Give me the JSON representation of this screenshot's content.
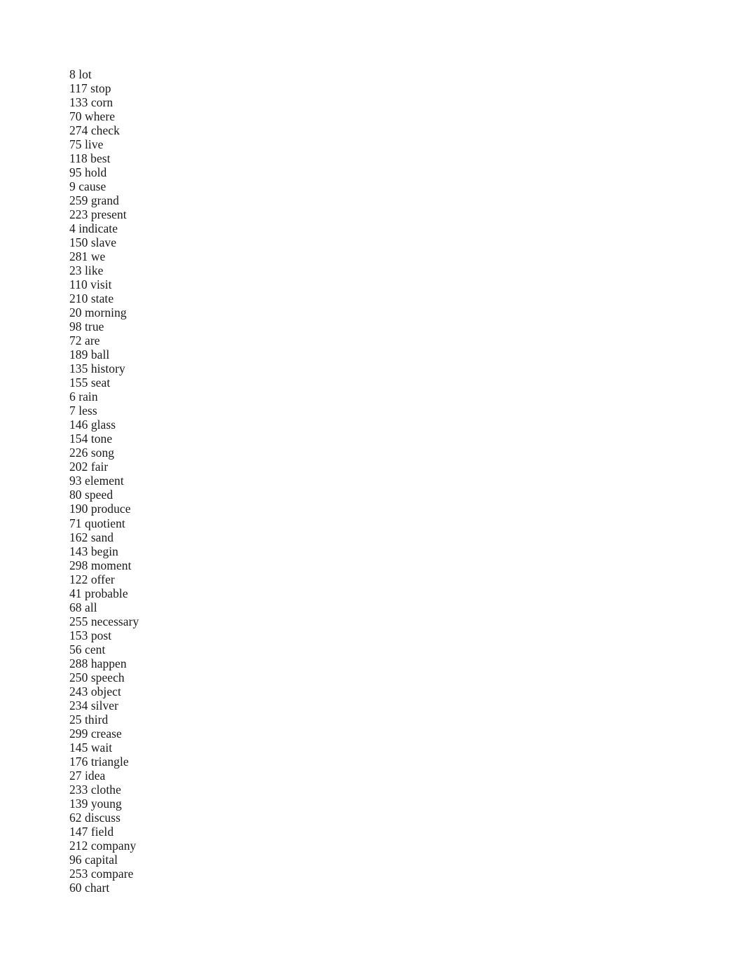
{
  "document": {
    "page_background": "#ffffff",
    "text_color": "#1a1a1a",
    "lines": [
      "8 lot",
      "117 stop",
      "133 corn",
      "70 where",
      "274 check",
      "75 live",
      "118 best",
      "95 hold",
      "9 cause",
      "259 grand",
      "223 present",
      "4 indicate",
      "150 slave",
      "281 we",
      "23 like",
      "110 visit",
      "210 state",
      "20 morning",
      "98 true",
      "72 are",
      "189 ball",
      "135 history",
      "155 seat",
      "6 rain",
      "7 less",
      "146 glass",
      "154 tone",
      "226 song",
      "202 fair",
      "93 element",
      "80 speed",
      "190 produce",
      "71 quotient",
      "162 sand",
      "143 begin",
      "298 moment",
      "122 offer",
      "41 probable",
      "68 all",
      "255 necessary",
      "153 post",
      "56 cent",
      "288 happen",
      "250 speech",
      "243 object",
      "234 silver",
      "25 third",
      "299 crease",
      "145 wait",
      "176 triangle",
      "27 idea",
      "233 clothe",
      "139 young",
      "62 discuss",
      "147 field",
      "212 company",
      "96 capital",
      "253 compare",
      "60 chart"
    ]
  }
}
